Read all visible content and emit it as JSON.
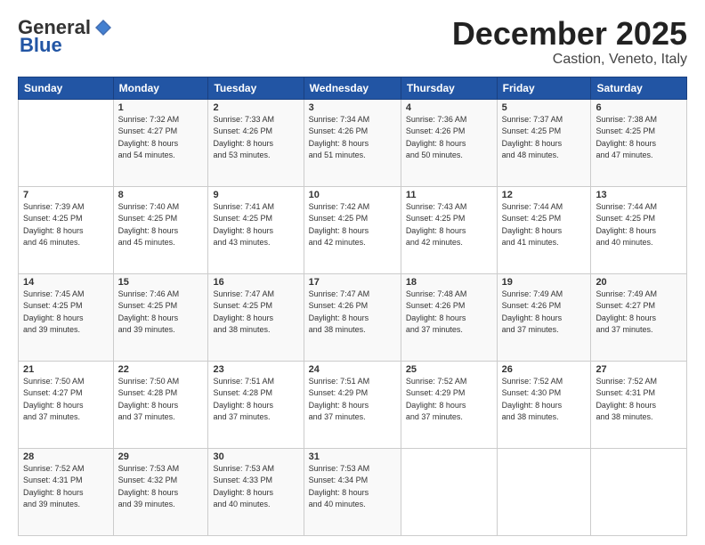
{
  "logo": {
    "general": "General",
    "blue": "Blue"
  },
  "header": {
    "month": "December 2025",
    "location": "Castion, Veneto, Italy"
  },
  "weekdays": [
    "Sunday",
    "Monday",
    "Tuesday",
    "Wednesday",
    "Thursday",
    "Friday",
    "Saturday"
  ],
  "weeks": [
    [
      {
        "day": "",
        "info": ""
      },
      {
        "day": "1",
        "info": "Sunrise: 7:32 AM\nSunset: 4:27 PM\nDaylight: 8 hours\nand 54 minutes."
      },
      {
        "day": "2",
        "info": "Sunrise: 7:33 AM\nSunset: 4:26 PM\nDaylight: 8 hours\nand 53 minutes."
      },
      {
        "day": "3",
        "info": "Sunrise: 7:34 AM\nSunset: 4:26 PM\nDaylight: 8 hours\nand 51 minutes."
      },
      {
        "day": "4",
        "info": "Sunrise: 7:36 AM\nSunset: 4:26 PM\nDaylight: 8 hours\nand 50 minutes."
      },
      {
        "day": "5",
        "info": "Sunrise: 7:37 AM\nSunset: 4:25 PM\nDaylight: 8 hours\nand 48 minutes."
      },
      {
        "day": "6",
        "info": "Sunrise: 7:38 AM\nSunset: 4:25 PM\nDaylight: 8 hours\nand 47 minutes."
      }
    ],
    [
      {
        "day": "7",
        "info": "Sunrise: 7:39 AM\nSunset: 4:25 PM\nDaylight: 8 hours\nand 46 minutes."
      },
      {
        "day": "8",
        "info": "Sunrise: 7:40 AM\nSunset: 4:25 PM\nDaylight: 8 hours\nand 45 minutes."
      },
      {
        "day": "9",
        "info": "Sunrise: 7:41 AM\nSunset: 4:25 PM\nDaylight: 8 hours\nand 43 minutes."
      },
      {
        "day": "10",
        "info": "Sunrise: 7:42 AM\nSunset: 4:25 PM\nDaylight: 8 hours\nand 42 minutes."
      },
      {
        "day": "11",
        "info": "Sunrise: 7:43 AM\nSunset: 4:25 PM\nDaylight: 8 hours\nand 42 minutes."
      },
      {
        "day": "12",
        "info": "Sunrise: 7:44 AM\nSunset: 4:25 PM\nDaylight: 8 hours\nand 41 minutes."
      },
      {
        "day": "13",
        "info": "Sunrise: 7:44 AM\nSunset: 4:25 PM\nDaylight: 8 hours\nand 40 minutes."
      }
    ],
    [
      {
        "day": "14",
        "info": "Sunrise: 7:45 AM\nSunset: 4:25 PM\nDaylight: 8 hours\nand 39 minutes."
      },
      {
        "day": "15",
        "info": "Sunrise: 7:46 AM\nSunset: 4:25 PM\nDaylight: 8 hours\nand 39 minutes."
      },
      {
        "day": "16",
        "info": "Sunrise: 7:47 AM\nSunset: 4:25 PM\nDaylight: 8 hours\nand 38 minutes."
      },
      {
        "day": "17",
        "info": "Sunrise: 7:47 AM\nSunset: 4:26 PM\nDaylight: 8 hours\nand 38 minutes."
      },
      {
        "day": "18",
        "info": "Sunrise: 7:48 AM\nSunset: 4:26 PM\nDaylight: 8 hours\nand 37 minutes."
      },
      {
        "day": "19",
        "info": "Sunrise: 7:49 AM\nSunset: 4:26 PM\nDaylight: 8 hours\nand 37 minutes."
      },
      {
        "day": "20",
        "info": "Sunrise: 7:49 AM\nSunset: 4:27 PM\nDaylight: 8 hours\nand 37 minutes."
      }
    ],
    [
      {
        "day": "21",
        "info": "Sunrise: 7:50 AM\nSunset: 4:27 PM\nDaylight: 8 hours\nand 37 minutes."
      },
      {
        "day": "22",
        "info": "Sunrise: 7:50 AM\nSunset: 4:28 PM\nDaylight: 8 hours\nand 37 minutes."
      },
      {
        "day": "23",
        "info": "Sunrise: 7:51 AM\nSunset: 4:28 PM\nDaylight: 8 hours\nand 37 minutes."
      },
      {
        "day": "24",
        "info": "Sunrise: 7:51 AM\nSunset: 4:29 PM\nDaylight: 8 hours\nand 37 minutes."
      },
      {
        "day": "25",
        "info": "Sunrise: 7:52 AM\nSunset: 4:29 PM\nDaylight: 8 hours\nand 37 minutes."
      },
      {
        "day": "26",
        "info": "Sunrise: 7:52 AM\nSunset: 4:30 PM\nDaylight: 8 hours\nand 38 minutes."
      },
      {
        "day": "27",
        "info": "Sunrise: 7:52 AM\nSunset: 4:31 PM\nDaylight: 8 hours\nand 38 minutes."
      }
    ],
    [
      {
        "day": "28",
        "info": "Sunrise: 7:52 AM\nSunset: 4:31 PM\nDaylight: 8 hours\nand 39 minutes."
      },
      {
        "day": "29",
        "info": "Sunrise: 7:53 AM\nSunset: 4:32 PM\nDaylight: 8 hours\nand 39 minutes."
      },
      {
        "day": "30",
        "info": "Sunrise: 7:53 AM\nSunset: 4:33 PM\nDaylight: 8 hours\nand 40 minutes."
      },
      {
        "day": "31",
        "info": "Sunrise: 7:53 AM\nSunset: 4:34 PM\nDaylight: 8 hours\nand 40 minutes."
      },
      {
        "day": "",
        "info": ""
      },
      {
        "day": "",
        "info": ""
      },
      {
        "day": "",
        "info": ""
      }
    ]
  ]
}
